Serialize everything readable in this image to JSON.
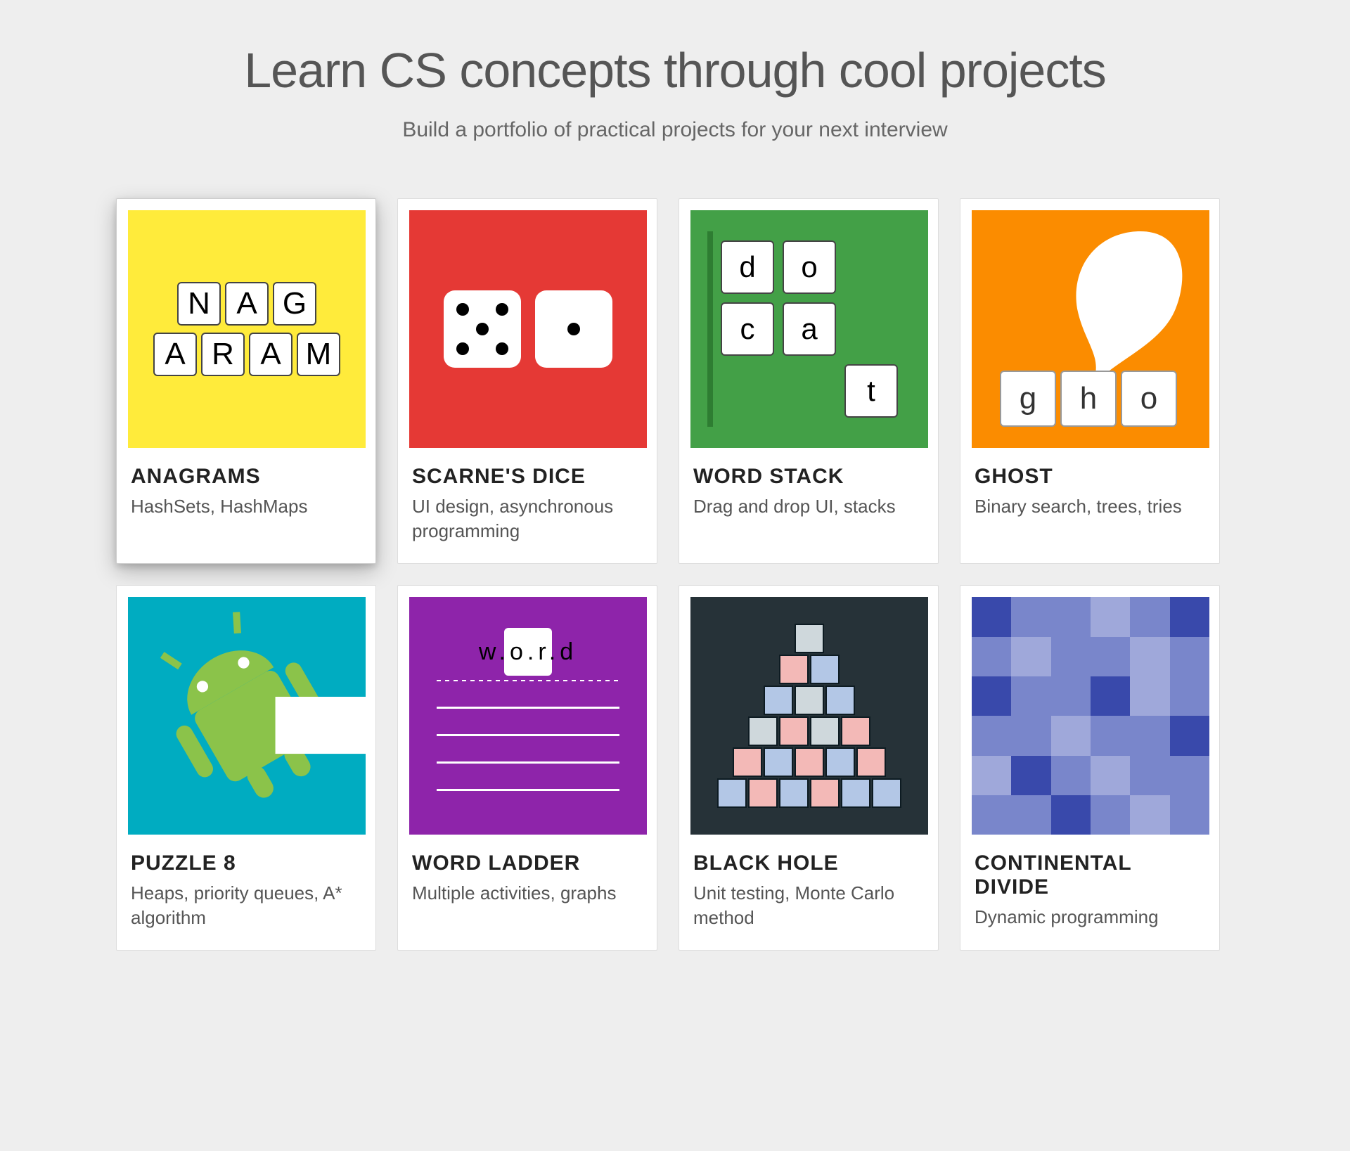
{
  "hero": {
    "title": "Learn CS concepts through cool projects",
    "subtitle": "Build a portfolio of practical projects for your next interview"
  },
  "cards": [
    {
      "id": "anagrams",
      "title": "ANAGRAMS",
      "subtitle": "HashSets, HashMaps",
      "bg": "#ffeb3b",
      "tiles_top": [
        "N",
        "A",
        "G"
      ],
      "tiles_bot": [
        "A",
        "R",
        "A",
        "M"
      ]
    },
    {
      "id": "scarnes-dice",
      "title": "SCARNE'S DICE",
      "subtitle": "UI design, asynchronous programming",
      "bg": "#e53935",
      "dice": [
        5,
        1
      ]
    },
    {
      "id": "word-stack",
      "title": "WORD STACK",
      "subtitle": "Drag and drop UI, stacks",
      "bg": "#43a047",
      "grid": [
        "d",
        "o",
        "",
        "c",
        "a",
        "",
        "",
        "",
        "t"
      ]
    },
    {
      "id": "ghost",
      "title": "GHOST",
      "subtitle": "Binary search, trees, tries",
      "bg": "#fb8c00",
      "tiles": [
        "g",
        "h",
        "o"
      ]
    },
    {
      "id": "puzzle-8",
      "title": "PUZZLE 8",
      "subtitle": "Heaps, priority queues, A* algorithm",
      "bg": "#00acc1"
    },
    {
      "id": "word-ladder",
      "title": "WORD LADDER",
      "subtitle": "Multiple activities, graphs",
      "bg": "#8e24aa",
      "word": "w.o.r.d",
      "blank_lines": 4
    },
    {
      "id": "black-hole",
      "title": "BLACK HOLE",
      "subtitle": "Unit testing, Monte Carlo method",
      "bg": "#263238",
      "pyramid": [
        [
          "g"
        ],
        [
          "p",
          "b"
        ],
        [
          "b",
          "g",
          "b"
        ],
        [
          "g",
          "p",
          "g",
          "p"
        ],
        [
          "p",
          "b",
          "p",
          "b",
          "p"
        ],
        [
          "b",
          "p",
          "b",
          "p",
          "b",
          "b"
        ]
      ]
    },
    {
      "id": "continental-divide",
      "title": "CONTINENTAL DIVIDE",
      "subtitle": "Dynamic programming",
      "bg": "#3f51b5",
      "cells": [
        "d",
        "m",
        "m",
        "l",
        "m",
        "d",
        "m",
        "l",
        "m",
        "m",
        "l",
        "m",
        "d",
        "m",
        "m",
        "d",
        "l",
        "m",
        "m",
        "m",
        "l",
        "m",
        "m",
        "d",
        "l",
        "d",
        "m",
        "l",
        "m",
        "m",
        "m",
        "m",
        "d",
        "m",
        "l",
        "m"
      ]
    }
  ]
}
